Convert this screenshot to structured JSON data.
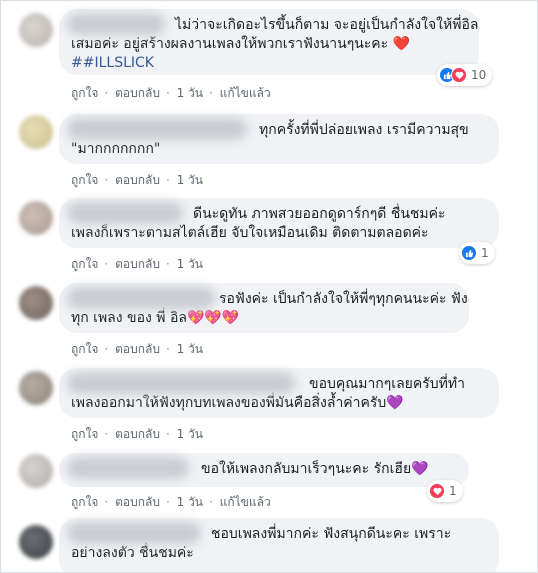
{
  "comments": [
    {
      "lines": [
        "ไม่ว่าจะเกิดอะไรขึ้นก็ตาม จะอยู่เป็นกำลังใจให้พี่อิล",
        "เสมอค่ะ อยู่สร้างผลงานเพลงให้พวกเราฟังนานๆนะคะ ❤️",
        "##ILLSLICK"
      ],
      "like": "ถูกใจ",
      "reply": "ตอบกลับ",
      "time": "1 วัน",
      "edited": "แก้ไขแล้ว",
      "reactions": {
        "types": [
          "like-icon",
          "love-icon"
        ],
        "count": "10"
      }
    },
    {
      "lines": [
        "ทุกครั้งที่พี่ปล่อยเพลง เรามีความสุข",
        "\"มากกกกกกก\""
      ],
      "like": "ถูกใจ",
      "reply": "ตอบกลับ",
      "time": "1 วัน"
    },
    {
      "lines": [
        "ดีนะดูทัน ภาพสวยออกดูดาร์กๆดี ชื่นชมค่ะ",
        "เพลงก็เพราะตามสไตล์เฮีย จับใจเหมือนเดิม ติดตามตลอดค่ะ"
      ],
      "like": "ถูกใจ",
      "reply": "ตอบกลับ",
      "time": "1 วัน",
      "reactions": {
        "types": [
          "like-icon"
        ],
        "count": "1"
      }
    },
    {
      "lines": [
        "รอฟังค่ะ เป็นกำลังใจให้พี่ๆทุกคนนะค่ะ ฟัง",
        "ทุก เพลง ของ พี่ อิล💖💖💖"
      ],
      "like": "ถูกใจ",
      "reply": "ตอบกลับ",
      "time": "1 วัน"
    },
    {
      "lines": [
        "ขอบคุณมากๆเลยครับที่ทำ",
        "เพลงออกมาให้ฟังทุกบทเพลงของพี่มันคือสิ่งล้ำค่าครับ💜"
      ],
      "like": "ถูกใจ",
      "reply": "ตอบกลับ",
      "time": "1 วัน"
    },
    {
      "lines": [
        "ขอให้เพลงกลับมาเร็วๆนะคะ รักเฮีย💜"
      ],
      "like": "ถูกใจ",
      "reply": "ตอบกลับ",
      "time": "1 วัน",
      "edited": "แก้ไขแล้ว",
      "reactions": {
        "types": [
          "love-icon"
        ],
        "count": "1"
      }
    },
    {
      "lines": [
        "ชอบเพลงพี่มากค่ะ ฟังสนุกดีนะคะ เพราะ",
        "อย่างลงตัว ชื่นชมค่ะ"
      ]
    }
  ],
  "colors": {
    "bubble": "#f0f2f5",
    "link": "#385898",
    "like": "#1877f2",
    "love": "#f33e58"
  }
}
